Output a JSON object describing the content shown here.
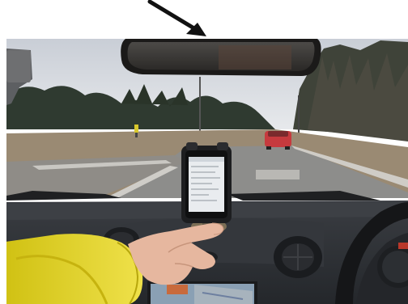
{
  "scene": {
    "arrow_color": "#111111",
    "sky_color": "#d9dde3",
    "road_color": "#8d8d8b",
    "dashboard_color": "#2f3237",
    "sleeve_color": "#e3d21e",
    "car_color": "#c63a3e",
    "phone_screen_color": "#e9ecef"
  },
  "phone": {
    "status_text": "",
    "title_text": ""
  },
  "navigation": {
    "label_line_1": "",
    "label_line_2": ""
  }
}
